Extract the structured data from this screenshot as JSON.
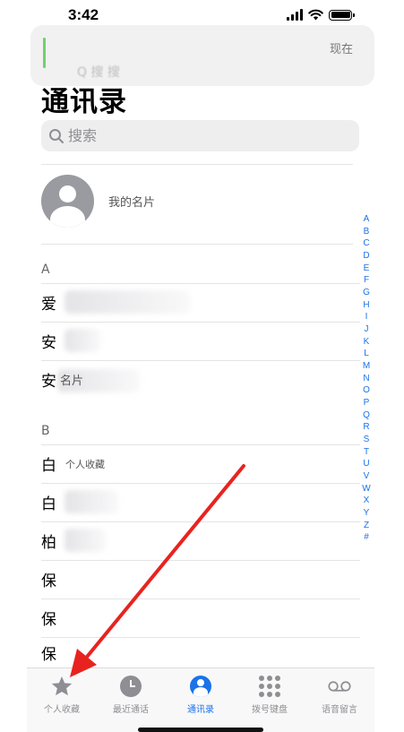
{
  "status_bar": {
    "time": "3:42"
  },
  "notification": {
    "time": "现在",
    "ghost_text": "Q 搜 搜"
  },
  "page": {
    "title": "通讯录"
  },
  "search": {
    "placeholder": "搜索"
  },
  "my_card": {
    "label": "我的名片"
  },
  "sections": [
    {
      "letter": "A",
      "rows": [
        {
          "name": "爱",
          "tag": ""
        },
        {
          "name": "安",
          "tag": ""
        },
        {
          "name": "安",
          "tag": "名片"
        }
      ]
    },
    {
      "letter": "B",
      "rows": [
        {
          "name": "白",
          "tag": "个人收藏"
        },
        {
          "name": "白",
          "tag": ""
        },
        {
          "name": "柏",
          "tag": ""
        },
        {
          "name": "保",
          "tag": ""
        },
        {
          "name": "保",
          "tag": ""
        },
        {
          "name": "保",
          "tag": ""
        }
      ]
    }
  ],
  "index_letters": [
    "A",
    "B",
    "C",
    "D",
    "E",
    "F",
    "G",
    "H",
    "I",
    "J",
    "K",
    "L",
    "M",
    "N",
    "O",
    "P",
    "Q",
    "R",
    "S",
    "T",
    "U",
    "V",
    "W",
    "X",
    "Y",
    "Z",
    "#"
  ],
  "tabs": [
    {
      "label": "个人收藏",
      "icon": "star-icon",
      "active": false
    },
    {
      "label": "最近通话",
      "icon": "clock-icon",
      "active": false
    },
    {
      "label": "通讯录",
      "icon": "contacts-icon",
      "active": true
    },
    {
      "label": "拨号键盘",
      "icon": "keypad-icon",
      "active": false
    },
    {
      "label": "语音留言",
      "icon": "voicemail-icon",
      "active": false
    }
  ],
  "colors": {
    "accent": "#1a73e8",
    "annotation_arrow": "#e8231f",
    "inactive": "#8e8e93"
  }
}
